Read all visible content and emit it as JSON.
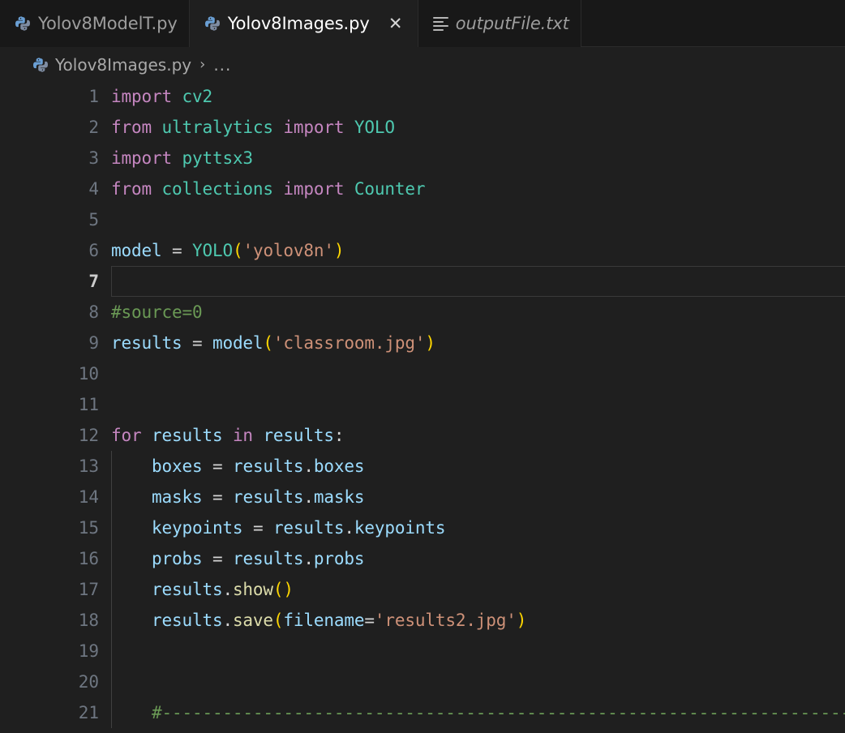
{
  "tabs": [
    {
      "label": "Yolov8ModelT.py",
      "icon": "python-icon",
      "active": false,
      "italic": false,
      "closable": false
    },
    {
      "label": "Yolov8Images.py",
      "icon": "python-icon",
      "active": true,
      "italic": false,
      "closable": true,
      "close_label": "✕"
    },
    {
      "label": "outputFile.txt",
      "icon": "text-file-icon",
      "active": false,
      "italic": true,
      "closable": false
    }
  ],
  "breadcrumb": {
    "icon": "python-icon",
    "file": "Yolov8Images.py",
    "separator": "›",
    "overflow": "..."
  },
  "editor": {
    "language": "python",
    "active_line": 7,
    "lines": [
      {
        "n": "1",
        "tokens": [
          {
            "t": "import",
            "c": "t-kw"
          },
          {
            "t": " ",
            "c": "t-pl"
          },
          {
            "t": "cv2",
            "c": "t-cls"
          }
        ]
      },
      {
        "n": "2",
        "tokens": [
          {
            "t": "from",
            "c": "t-kw"
          },
          {
            "t": " ",
            "c": "t-pl"
          },
          {
            "t": "ultralytics",
            "c": "t-cls"
          },
          {
            "t": " ",
            "c": "t-pl"
          },
          {
            "t": "import",
            "c": "t-kw"
          },
          {
            "t": " ",
            "c": "t-pl"
          },
          {
            "t": "YOLO",
            "c": "t-cls"
          }
        ]
      },
      {
        "n": "3",
        "tokens": [
          {
            "t": "import",
            "c": "t-kw"
          },
          {
            "t": " ",
            "c": "t-pl"
          },
          {
            "t": "pyttsx3",
            "c": "t-cls"
          }
        ]
      },
      {
        "n": "4",
        "tokens": [
          {
            "t": "from",
            "c": "t-kw"
          },
          {
            "t": " ",
            "c": "t-pl"
          },
          {
            "t": "collections",
            "c": "t-cls"
          },
          {
            "t": " ",
            "c": "t-pl"
          },
          {
            "t": "import",
            "c": "t-kw"
          },
          {
            "t": " ",
            "c": "t-pl"
          },
          {
            "t": "Counter",
            "c": "t-cls"
          }
        ]
      },
      {
        "n": "5",
        "tokens": []
      },
      {
        "n": "6",
        "tokens": [
          {
            "t": "model",
            "c": "t-var"
          },
          {
            "t": " ",
            "c": "t-pl"
          },
          {
            "t": "=",
            "c": "t-op"
          },
          {
            "t": " ",
            "c": "t-pl"
          },
          {
            "t": "YOLO",
            "c": "t-cls"
          },
          {
            "t": "(",
            "c": "t-br"
          },
          {
            "t": "'yolov8n'",
            "c": "t-str"
          },
          {
            "t": ")",
            "c": "t-br"
          }
        ]
      },
      {
        "n": "7",
        "tokens": []
      },
      {
        "n": "8",
        "tokens": [
          {
            "t": "#source=0",
            "c": "t-com"
          }
        ]
      },
      {
        "n": "9",
        "tokens": [
          {
            "t": "results",
            "c": "t-var"
          },
          {
            "t": " ",
            "c": "t-pl"
          },
          {
            "t": "=",
            "c": "t-op"
          },
          {
            "t": " ",
            "c": "t-pl"
          },
          {
            "t": "model",
            "c": "t-var"
          },
          {
            "t": "(",
            "c": "t-br"
          },
          {
            "t": "'classroom.jpg'",
            "c": "t-str"
          },
          {
            "t": ")",
            "c": "t-br"
          }
        ]
      },
      {
        "n": "10",
        "tokens": []
      },
      {
        "n": "11",
        "tokens": []
      },
      {
        "n": "12",
        "tokens": [
          {
            "t": "for",
            "c": "t-kw"
          },
          {
            "t": " ",
            "c": "t-pl"
          },
          {
            "t": "results",
            "c": "t-var"
          },
          {
            "t": " ",
            "c": "t-pl"
          },
          {
            "t": "in",
            "c": "t-kw"
          },
          {
            "t": " ",
            "c": "t-pl"
          },
          {
            "t": "results",
            "c": "t-var"
          },
          {
            "t": ":",
            "c": "t-op"
          }
        ]
      },
      {
        "n": "13",
        "tokens": [
          {
            "t": "    ",
            "c": "t-pl"
          },
          {
            "t": "boxes",
            "c": "t-var"
          },
          {
            "t": " ",
            "c": "t-pl"
          },
          {
            "t": "=",
            "c": "t-op"
          },
          {
            "t": " ",
            "c": "t-pl"
          },
          {
            "t": "results",
            "c": "t-var"
          },
          {
            "t": ".",
            "c": "t-op"
          },
          {
            "t": "boxes",
            "c": "t-var"
          }
        ]
      },
      {
        "n": "14",
        "tokens": [
          {
            "t": "    ",
            "c": "t-pl"
          },
          {
            "t": "masks",
            "c": "t-var"
          },
          {
            "t": " ",
            "c": "t-pl"
          },
          {
            "t": "=",
            "c": "t-op"
          },
          {
            "t": " ",
            "c": "t-pl"
          },
          {
            "t": "results",
            "c": "t-var"
          },
          {
            "t": ".",
            "c": "t-op"
          },
          {
            "t": "masks",
            "c": "t-var"
          }
        ]
      },
      {
        "n": "15",
        "tokens": [
          {
            "t": "    ",
            "c": "t-pl"
          },
          {
            "t": "keypoints",
            "c": "t-var"
          },
          {
            "t": " ",
            "c": "t-pl"
          },
          {
            "t": "=",
            "c": "t-op"
          },
          {
            "t": " ",
            "c": "t-pl"
          },
          {
            "t": "results",
            "c": "t-var"
          },
          {
            "t": ".",
            "c": "t-op"
          },
          {
            "t": "keypoints",
            "c": "t-var"
          }
        ]
      },
      {
        "n": "16",
        "tokens": [
          {
            "t": "    ",
            "c": "t-pl"
          },
          {
            "t": "probs",
            "c": "t-var"
          },
          {
            "t": " ",
            "c": "t-pl"
          },
          {
            "t": "=",
            "c": "t-op"
          },
          {
            "t": " ",
            "c": "t-pl"
          },
          {
            "t": "results",
            "c": "t-var"
          },
          {
            "t": ".",
            "c": "t-op"
          },
          {
            "t": "probs",
            "c": "t-var"
          }
        ]
      },
      {
        "n": "17",
        "tokens": [
          {
            "t": "    ",
            "c": "t-pl"
          },
          {
            "t": "results",
            "c": "t-var"
          },
          {
            "t": ".",
            "c": "t-op"
          },
          {
            "t": "show",
            "c": "t-fn"
          },
          {
            "t": "()",
            "c": "t-br"
          }
        ]
      },
      {
        "n": "18",
        "tokens": [
          {
            "t": "    ",
            "c": "t-pl"
          },
          {
            "t": "results",
            "c": "t-var"
          },
          {
            "t": ".",
            "c": "t-op"
          },
          {
            "t": "save",
            "c": "t-fn"
          },
          {
            "t": "(",
            "c": "t-br"
          },
          {
            "t": "filename",
            "c": "t-var"
          },
          {
            "t": "=",
            "c": "t-op"
          },
          {
            "t": "'results2.jpg'",
            "c": "t-str"
          },
          {
            "t": ")",
            "c": "t-br"
          }
        ]
      },
      {
        "n": "19",
        "tokens": []
      },
      {
        "n": "20",
        "tokens": []
      },
      {
        "n": "21",
        "tokens": [
          {
            "t": "    ",
            "c": "t-pl"
          },
          {
            "t": "#------------------------------------------------------------------------",
            "c": "t-com"
          }
        ]
      }
    ]
  },
  "colors": {
    "editor_background": "#1f1f1f",
    "tabbar_background": "#181818",
    "active_tab_background": "#1f1f1f",
    "keyword": "#c586c0",
    "class_module": "#4ec9b0",
    "variable": "#9cdcfe",
    "string": "#ce9178",
    "comment": "#6a9955",
    "function": "#dcdcaa",
    "bracket": "#ffd700",
    "line_number": "#6e7681",
    "active_line_number": "#cccccc"
  }
}
